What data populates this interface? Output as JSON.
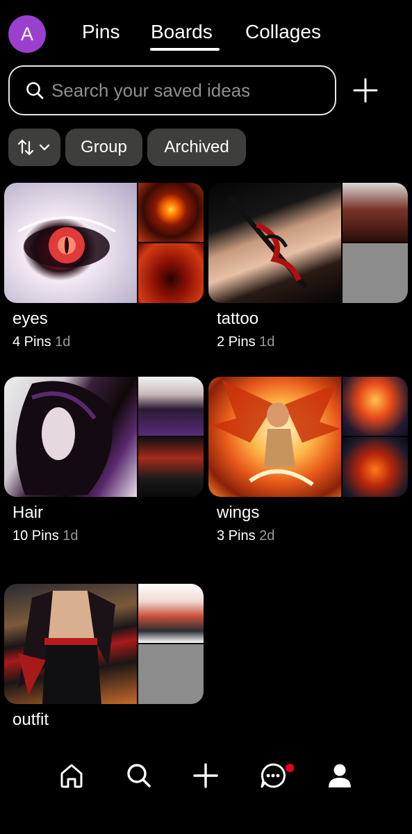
{
  "header": {
    "avatar_letter": "A",
    "avatar_color": "#9b3fcf",
    "tabs": [
      {
        "label": "Pins",
        "active": false
      },
      {
        "label": "Boards",
        "active": true
      },
      {
        "label": "Collages",
        "active": false
      }
    ]
  },
  "search": {
    "placeholder": "Search your saved ideas",
    "icon": "search-icon",
    "add_icon": "plus-icon"
  },
  "filters": {
    "sort_icon": "sort-arrows-icon",
    "chips": [
      "Group",
      "Archived"
    ]
  },
  "boards": [
    {
      "title": "eyes",
      "count": "4 Pins",
      "age": "1d"
    },
    {
      "title": "tattoo",
      "count": "2 Pins",
      "age": "1d"
    },
    {
      "title": "Hair",
      "count": "10 Pins",
      "age": "1d"
    },
    {
      "title": "wings",
      "count": "3 Pins",
      "age": "2d"
    },
    {
      "title": "outfit",
      "count": "",
      "age": ""
    }
  ],
  "bottom_nav": {
    "items": [
      "home-icon",
      "search-icon",
      "create-icon",
      "messages-icon",
      "profile-icon"
    ],
    "notification_color": "#e60023"
  }
}
